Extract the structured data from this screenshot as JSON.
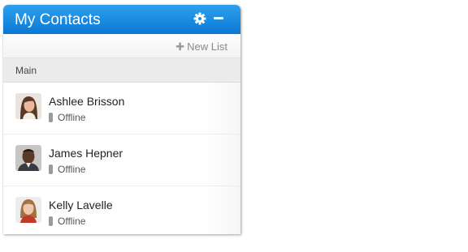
{
  "panel": {
    "title": "My Contacts",
    "settings_icon": "gear-icon",
    "minimize_icon": "minimize-icon"
  },
  "toolbar": {
    "new_list_icon": "plus-icon",
    "new_list_label": "New List"
  },
  "group": {
    "label": "Main"
  },
  "contacts": [
    {
      "name": "Ashlee Brisson",
      "status": "Offline"
    },
    {
      "name": "James Hepner",
      "status": "Offline"
    },
    {
      "name": "Kelly Lavelle",
      "status": "Offline"
    }
  ],
  "colors": {
    "header_top": "#2fa0ee",
    "header_bottom": "#0a78d4",
    "offline_indicator": "#9a9a9a"
  }
}
